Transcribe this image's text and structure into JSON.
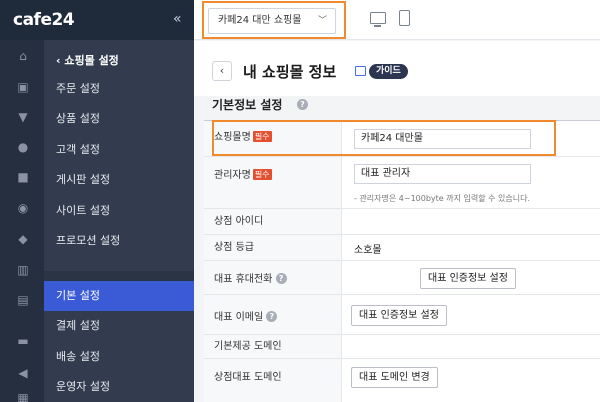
{
  "app": {
    "logo": "cafe24",
    "collapse": "«"
  },
  "topbar": {
    "shop_select": "카페24 대만 쇼핑몰"
  },
  "menu": {
    "back_label": "쇼핑몰 설정",
    "items_top": [
      "주문 설정",
      "상품 설정",
      "고객 설정",
      "게시판 설정",
      "사이트 설정",
      "프로모션 설정"
    ],
    "items_bottom": [
      "기본 설정",
      "결제 설정",
      "배송 설정",
      "운영자 설정"
    ],
    "active": "기본 설정"
  },
  "page": {
    "title": "내 쇼핑몰 정보",
    "guide": "가이드"
  },
  "section": {
    "title": "기본정보 설정"
  },
  "form": {
    "required_badge": "필수",
    "shop_name": {
      "label": "쇼핑몰명",
      "value": "카페24 대만몰"
    },
    "admin_name": {
      "label": "관리자명",
      "value": "대표 관리자",
      "note": "- 관리자명은 4~100byte 까지 입력할 수 있습니다."
    },
    "shop_id": {
      "label": "상점 아이디"
    },
    "shop_grade": {
      "label": "상점 등급",
      "value": "소호몰"
    },
    "phone": {
      "label": "대표 휴대전화",
      "button": "대표 인증정보 설정"
    },
    "email": {
      "label": "대표 이메일",
      "button": "대표 인증정보 설정"
    },
    "base_domain": {
      "label": "기본제공 도메인"
    },
    "main_domain": {
      "label": "상점대표 도메인",
      "button": "대표 도메인 변경"
    }
  }
}
